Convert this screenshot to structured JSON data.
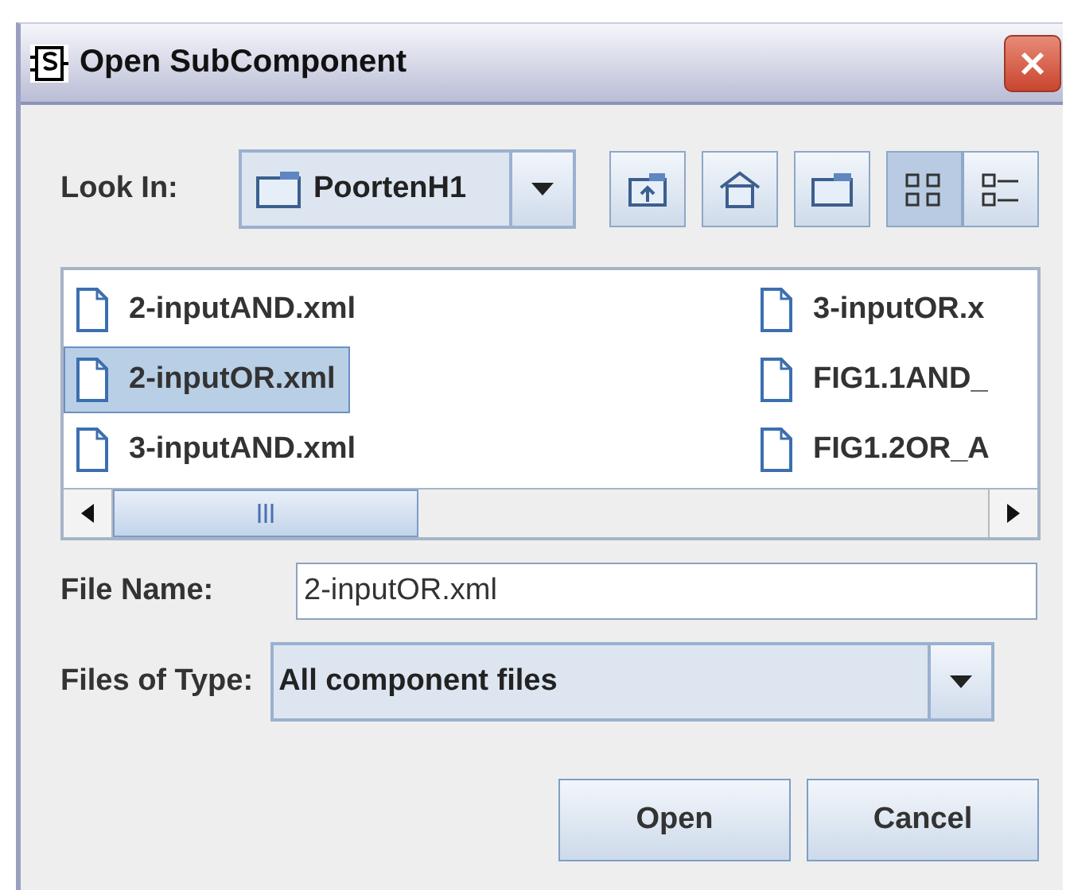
{
  "window": {
    "title": "Open SubComponent"
  },
  "look_in": {
    "label": "Look In:",
    "value": "PoortenH1"
  },
  "toolbar": [
    {
      "kind": "up"
    },
    {
      "kind": "home"
    },
    {
      "kind": "new-folder"
    },
    {
      "kind": "list",
      "selected": true
    },
    {
      "kind": "details",
      "selected": false
    }
  ],
  "files": [
    {
      "name": "2-inputAND.xml",
      "selected": false
    },
    {
      "name": "2-inputOR.xml",
      "selected": true
    },
    {
      "name": "3-inputAND.xml",
      "selected": false
    },
    {
      "name": "3-inputOR.x",
      "selected": false
    },
    {
      "name": "FIG1.1AND_",
      "selected": false
    },
    {
      "name": "FIG1.2OR_A",
      "selected": false
    }
  ],
  "file_name": {
    "label": "File Name:",
    "value": "2-inputOR.xml"
  },
  "file_type": {
    "label": "Files of Type:",
    "value": "All component files"
  },
  "buttons": [
    "Open",
    "Cancel"
  ]
}
